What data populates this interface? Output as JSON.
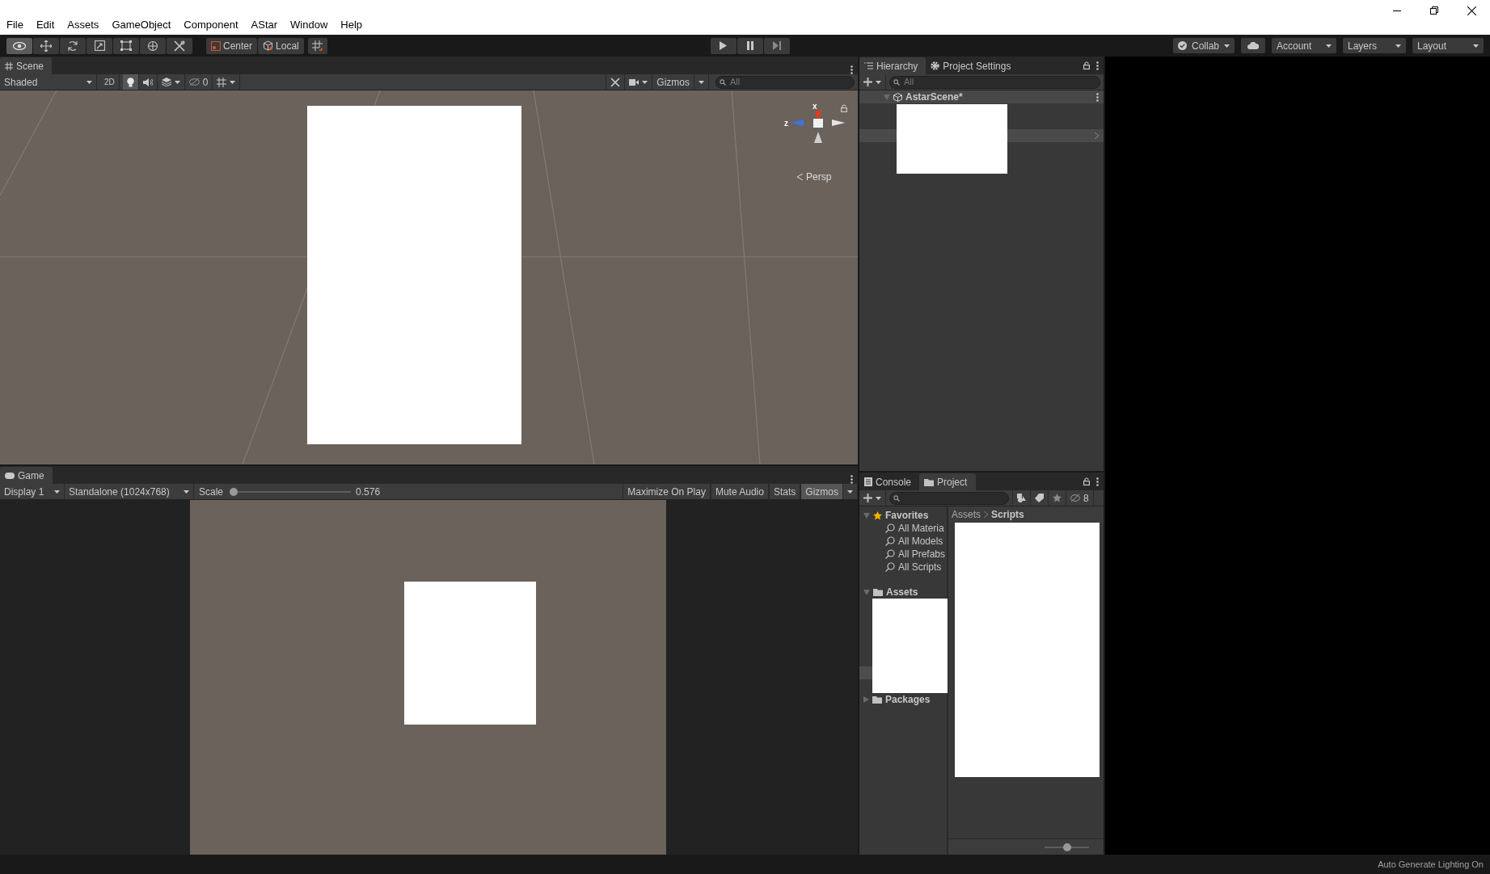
{
  "menu": [
    "File",
    "Edit",
    "Assets",
    "GameObject",
    "Component",
    "AStar",
    "Window",
    "Help"
  ],
  "toolbar": {
    "tools": [
      {
        "kind": "view",
        "selected": true
      },
      {
        "kind": "move",
        "selected": false
      },
      {
        "kind": "rotate",
        "selected": false
      },
      {
        "kind": "scale",
        "selected": false
      },
      {
        "kind": "rect",
        "selected": false
      },
      {
        "kind": "transform",
        "selected": false
      },
      {
        "kind": "custom",
        "selected": false
      }
    ],
    "pivot": "Center",
    "space": "Local",
    "collab": "Collab",
    "account": "Account",
    "layers": "Layers",
    "layout": "Layout"
  },
  "scene": {
    "tab": "Scene",
    "shading": "Shaded",
    "mode_2d": "2D",
    "hidden_count": "0",
    "gizmos": "Gizmos",
    "search": {
      "placeholder": "All"
    },
    "axis_labels": [
      "x",
      "z"
    ],
    "projection": "Persp"
  },
  "game": {
    "tab": "Game",
    "display": "Display 1",
    "resolution": "Standalone (1024x768)",
    "scale_label": "Scale",
    "scale": {
      "level": 0.0
    },
    "scale_value": "0.576",
    "toggles": [
      {
        "label": "Maximize On Play",
        "on": false
      },
      {
        "label": "Mute Audio",
        "on": false
      },
      {
        "label": "Stats",
        "on": false
      },
      {
        "label": "Gizmos",
        "on": true
      }
    ]
  },
  "hierarchy": {
    "tabs": [
      {
        "label": "Hierarchy",
        "selected": true
      },
      {
        "label": "Project Settings",
        "selected": false
      }
    ],
    "search": {
      "placeholder": "All"
    },
    "scene": "AstarScene*"
  },
  "project": {
    "tabs": [
      {
        "label": "Console",
        "selected": false
      },
      {
        "label": "Project",
        "selected": true
      }
    ],
    "hidden_count": "8",
    "favorites": {
      "label": "Favorites",
      "expanded": true,
      "children": [
        "All Materia",
        "All Models",
        "All Prefabs",
        "All Scripts"
      ]
    },
    "folders": [
      {
        "label": "Assets",
        "expanded": true
      },
      {
        "label": "Packages",
        "expanded": false
      }
    ],
    "breadcrumb": [
      "Assets",
      "Scripts"
    ],
    "icon_size": {
      "level": 0.5
    }
  },
  "status_bar": {
    "text": "Auto Generate Lighting On"
  }
}
